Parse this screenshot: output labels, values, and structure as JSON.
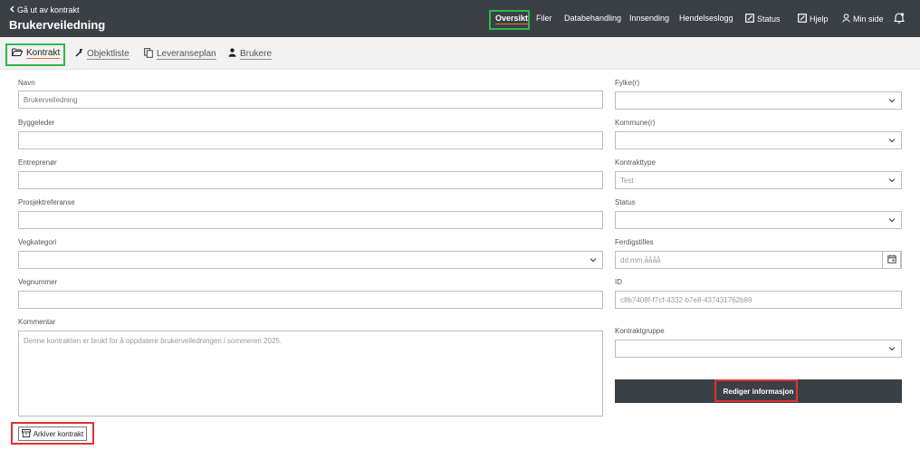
{
  "header": {
    "back_label": "Gå ut av kontrakt",
    "title": "Brukerveiledning",
    "nav": {
      "oversikt": "Oversikt",
      "filer": "Filer",
      "databehandling": "Databehandling",
      "innsending": "Innsending",
      "hendelseslogg": "Hendelseslogg",
      "status": "Status",
      "hjelp": "Hjelp",
      "min_side": "Min side"
    }
  },
  "tabs": {
    "kontrakt": "Kontrakt",
    "objektliste": "Objektliste",
    "leveranseplan": "Leveranseplan",
    "brukere": "Brukere"
  },
  "form": {
    "navn": {
      "label": "Navn",
      "placeholder": "Brukerveiledning"
    },
    "byggeleder": {
      "label": "Byggeleder",
      "value": ""
    },
    "entreprenor": {
      "label": "Entreprenør",
      "value": ""
    },
    "prosjektreferanse": {
      "label": "Prosjektreferanse",
      "value": ""
    },
    "vegkategori": {
      "label": "Vegkategori",
      "value": ""
    },
    "vegnummer": {
      "label": "Vegnummer",
      "value": ""
    },
    "kommentar": {
      "label": "Kommentar",
      "value": "Denne kontrakten er brukt for å oppdatere brukerveiledningen i sommeren 2025."
    },
    "fylke": {
      "label": "Fylke(r)",
      "value": ""
    },
    "kommune": {
      "label": "Kommune(r)",
      "value": ""
    },
    "kontrakttype": {
      "label": "Kontrakttype",
      "value": "Test"
    },
    "status": {
      "label": "Status",
      "value": ""
    },
    "ferdigstilles": {
      "label": "Ferdigstilles",
      "placeholder": "dd.mm.åååå"
    },
    "id": {
      "label": "ID",
      "value": "c8b7408f-f7cf-4332-b7e8-437431762b89"
    },
    "kontraktgruppe": {
      "label": "Kontraktgruppe",
      "value": ""
    }
  },
  "buttons": {
    "rediger": "Rediger informasjon",
    "arkiver": "Arkiver kontrakt"
  },
  "colors": {
    "header_bg": "#3b4045",
    "accent_underline": "#f26f3c",
    "highlight_green": "#2db84b",
    "highlight_red": "#e03232"
  }
}
